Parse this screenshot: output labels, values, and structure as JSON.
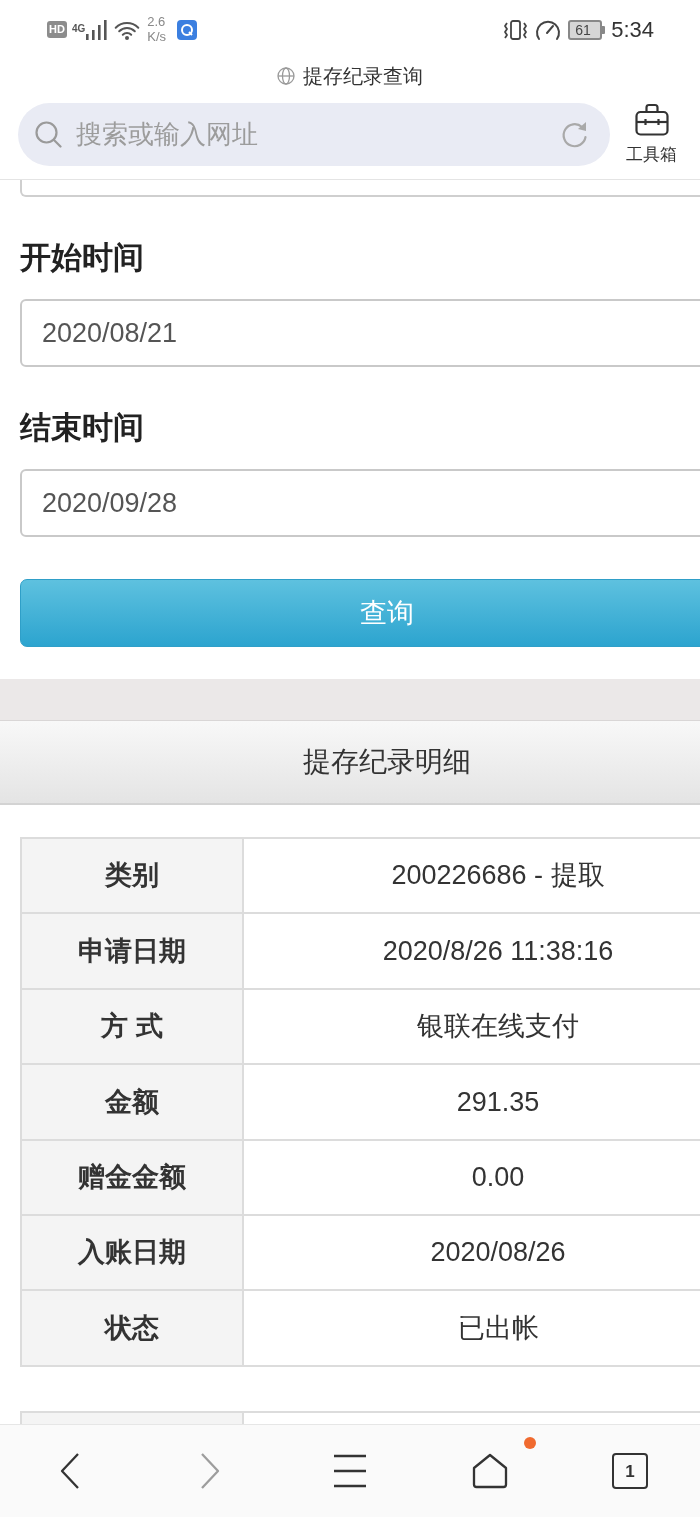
{
  "status_bar": {
    "network_badge": "HD",
    "network_type": "4G",
    "speed": "2.6",
    "speed_unit": "K/s",
    "battery": "61",
    "time": "5:34"
  },
  "browser": {
    "page_title": "提存纪录查询",
    "address_bar": {
      "placeholder": "搜索或输入网址"
    },
    "toolbox": "工具箱"
  },
  "query_form": {
    "fields": [
      {
        "label": "开始时间",
        "value": "2020/08/21"
      },
      {
        "label": "结束时间",
        "value": "2020/09/28"
      }
    ],
    "submit_button": "查询"
  },
  "details": {
    "title": "提存纪录明细",
    "rows": [
      {
        "label": "类别",
        "value": "200226686 - 提取"
      },
      {
        "label": "申请日期",
        "value": "2020/8/26 11:38:16"
      },
      {
        "label": "方 式",
        "value": "银联在线支付"
      },
      {
        "label": "金额",
        "value": "291.35"
      },
      {
        "label": "赠金金额",
        "value": "0.00"
      },
      {
        "label": "入账日期",
        "value": "2020/08/26"
      },
      {
        "label": "状态",
        "value": "已出帐"
      }
    ]
  },
  "bottom_bar": {
    "buttons": [
      {
        "kind": "back",
        "disabled": false,
        "notification": false
      },
      {
        "kind": "forward",
        "disabled": true,
        "notification": false
      },
      {
        "kind": "menu",
        "disabled": false,
        "notification": false
      },
      {
        "kind": "home",
        "disabled": false,
        "notification": true
      },
      {
        "kind": "tabs",
        "disabled": false,
        "notification": false,
        "count": "1"
      }
    ]
  }
}
